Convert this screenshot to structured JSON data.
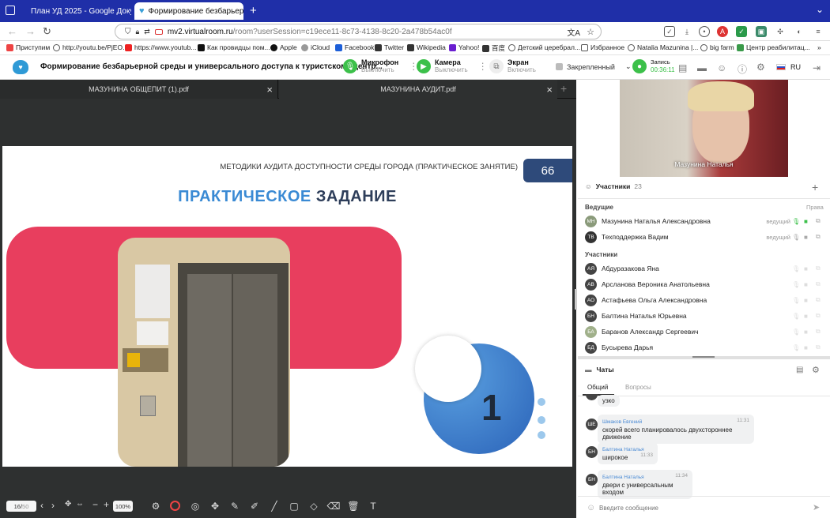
{
  "browser": {
    "tabs": [
      {
        "title": "План УД 2025 - Google Докуме"
      },
      {
        "title": "Формирование безбарьерной"
      }
    ],
    "url_host": "mv2.virtualroom.ru",
    "url_path": "/room?userSession=c19ece11-8c73-4138-8c20-2a478b54ac0f",
    "bookmarks": [
      "Приступим",
      "http://youtu.be/PjEO...",
      "https://www.youtub...",
      "Как провидцы пом...",
      "Apple",
      "iCloud",
      "Facebook",
      "Twitter",
      "Wikipedia",
      "Yahoo!",
      "百度",
      "Детский церебрал...",
      "Избранное",
      "Natalia Mazunina |...",
      "big farm",
      "Центр реабилитац..."
    ]
  },
  "app": {
    "title": "Формирование безбарьерной среды и универсального доступа к туристскому центр...",
    "mic": {
      "label": "Микрофон",
      "action": "Выключить"
    },
    "camera": {
      "label": "Камера",
      "action": "Выключить"
    },
    "screen": {
      "label": "Экран",
      "action": "Включить"
    },
    "layout": "Закрепленный",
    "record": {
      "label": "Запись",
      "time": "00:36:11"
    },
    "lang": "RU"
  },
  "docs": {
    "tabs": [
      "МАЗУНИНА ОБЩЕПИТ (1).pdf",
      "МАЗУНИНА АУДИТ.pdf"
    ],
    "page_current": "16",
    "page_total": "50",
    "zoom": "100%"
  },
  "slide": {
    "header": "МЕТОДИКИ АУДИТА ДОСТУПНОСТИ СРЕДЫ ГОРОДА (ПРАКТИЧЕСКОЕ ЗАНЯТИЕ)",
    "number": "66",
    "title_part1": "ПРАКТИЧЕСКОЕ",
    "title_part2": "ЗАДАНИЕ",
    "big_number": "1"
  },
  "video": {
    "name": "Мазунина Наталья"
  },
  "participants": {
    "label": "Участники",
    "count": "23",
    "rights_label": "Права",
    "hosts_label": "Ведущие",
    "members_label": "Участники",
    "hosts": [
      {
        "initials": "МН",
        "name": "Мазунина Наталья Александровна",
        "role": "ведущий",
        "color": "#8a9a7a"
      },
      {
        "initials": "ТВ",
        "name": "Техподдержка Вадим",
        "role": "ведущий",
        "color": "#333"
      }
    ],
    "members": [
      {
        "initials": "АЯ",
        "name": "Абдуразакова Яна",
        "color": "#444"
      },
      {
        "initials": "АВ",
        "name": "Арсланова Вероника Анатольевна",
        "color": "#444"
      },
      {
        "initials": "АО",
        "name": "Астафьева Ольга Александровна",
        "color": "#444"
      },
      {
        "initials": "БН",
        "name": "Балтина Наталья Юрьевна",
        "color": "#444"
      },
      {
        "initials": "БА",
        "name": "Баранов Александр Сергеевич",
        "color": "#a0b08a"
      },
      {
        "initials": "БД",
        "name": "Бусырева Дарья",
        "color": "#444"
      }
    ]
  },
  "chat": {
    "label": "Чаты",
    "tabs": [
      "Общий",
      "Вопросы"
    ],
    "messages": [
      {
        "initials": "",
        "name": "",
        "time": "",
        "text": "узко"
      },
      {
        "initials": "ШЕ",
        "name": "Шмаков Евгений",
        "time": "11:31",
        "text": "скорей всего планировалось двухстороннее движение"
      },
      {
        "initials": "БН",
        "name": "Балтина Наталья",
        "time": "11:33",
        "text": "широкое"
      },
      {
        "initials": "БН",
        "name": "Балтина Наталья",
        "time": "11:34",
        "text": "двери с универсальным входом"
      }
    ],
    "placeholder": "Введите сообщение"
  }
}
